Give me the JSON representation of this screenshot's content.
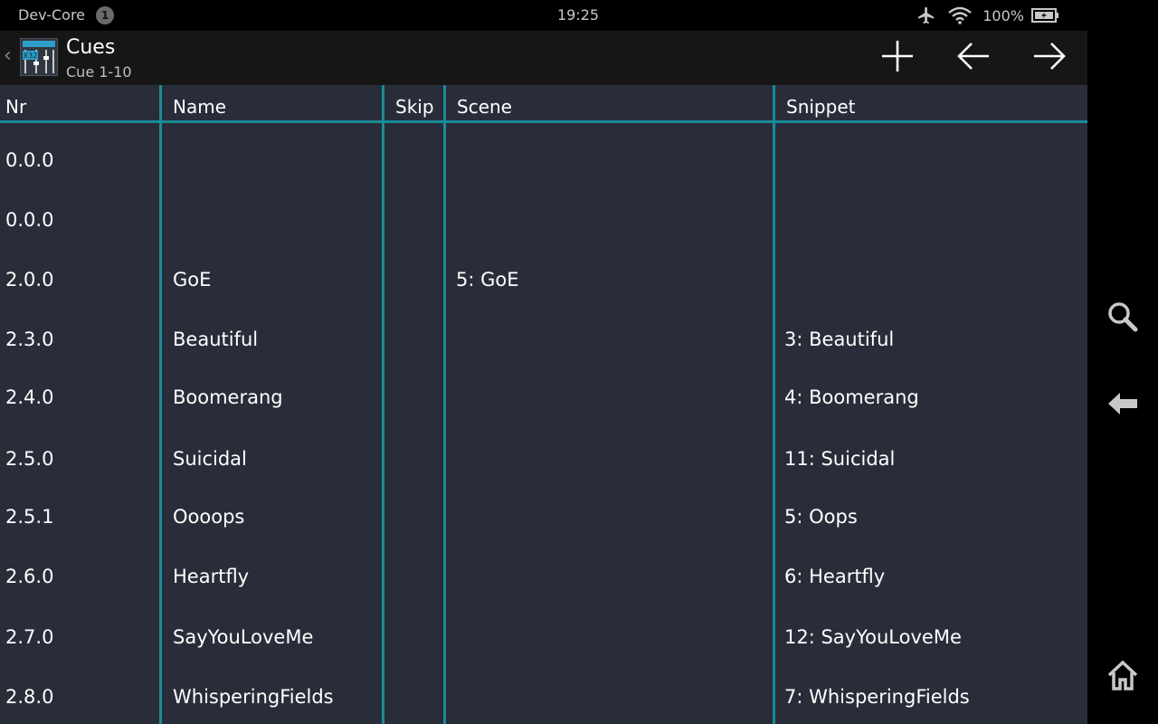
{
  "status_bar": {
    "carrier": "Dev-Core",
    "notification_count": "1",
    "time": "19:25",
    "battery": "100%"
  },
  "action_bar": {
    "title": "Cues",
    "subtitle": "Cue 1-10",
    "app_icon_label": "X32",
    "icons": [
      "add-icon",
      "arrow-left-icon",
      "arrow-right-icon"
    ]
  },
  "table": {
    "headers": {
      "nr": "Nr",
      "name": "Name",
      "skip": "Skip",
      "scene": "Scene",
      "snippet": "Snippet"
    },
    "rows": [
      {
        "nr": "0.0.0",
        "name": "",
        "skip": "",
        "scene": "",
        "snippet": ""
      },
      {
        "nr": "0.0.0",
        "name": "",
        "skip": "",
        "scene": "",
        "snippet": ""
      },
      {
        "nr": "2.0.0",
        "name": "GoE",
        "skip": "",
        "scene": "5: GoE",
        "snippet": ""
      },
      {
        "nr": "2.3.0",
        "name": "Beautiful",
        "skip": "",
        "scene": "",
        "snippet": "3: Beautiful"
      },
      {
        "nr": "2.4.0",
        "name": "Boomerang",
        "skip": "",
        "scene": "",
        "snippet": "4: Boomerang"
      },
      {
        "nr": "2.5.0",
        "name": "Suicidal",
        "skip": "",
        "scene": "",
        "snippet": "11: Suicidal"
      },
      {
        "nr": "2.5.1",
        "name": "Oooops",
        "skip": "",
        "scene": "",
        "snippet": "5: Oops"
      },
      {
        "nr": "2.6.0",
        "name": "Heartfly",
        "skip": "",
        "scene": "",
        "snippet": "6: Heartfly"
      },
      {
        "nr": "2.7.0",
        "name": "SayYouLoveMe",
        "skip": "",
        "scene": "",
        "snippet": "12: SayYouLoveMe"
      },
      {
        "nr": "2.8.0",
        "name": "WhisperingFields",
        "skip": "",
        "scene": "",
        "snippet": "7: WhisperingFields"
      }
    ]
  },
  "nav_bar": {
    "icons": [
      "search-icon",
      "back-icon",
      "home-icon"
    ]
  },
  "colors": {
    "background": "#282d39",
    "accent": "#1b8a98",
    "bars": "#000000",
    "action_bar": "#161616"
  }
}
